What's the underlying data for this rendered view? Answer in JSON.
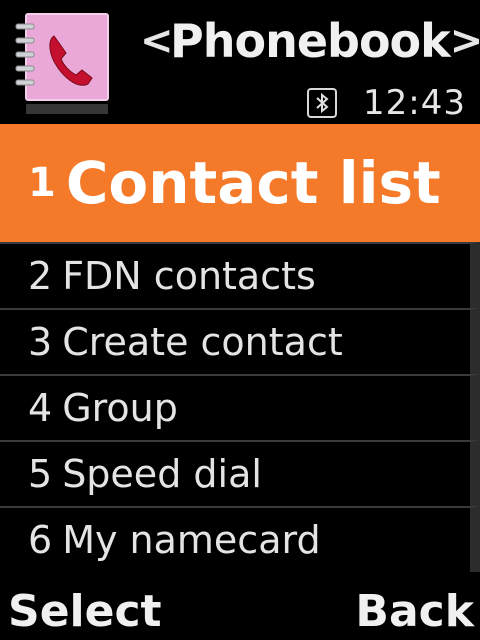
{
  "header": {
    "title": "Phonebook",
    "prev_icon": "chevron-left-icon",
    "next_icon": "chevron-right-icon",
    "app_icon": "phonebook-handset-icon"
  },
  "status": {
    "bluetooth_icon": "bluetooth-icon",
    "time": "12:43"
  },
  "menu": {
    "items": [
      {
        "num": "1",
        "label": "Contact list"
      },
      {
        "num": "2",
        "label": "FDN contacts"
      },
      {
        "num": "3",
        "label": "Create contact"
      },
      {
        "num": "4",
        "label": "Group"
      },
      {
        "num": "5",
        "label": "Speed dial"
      },
      {
        "num": "6",
        "label": "My namecard"
      }
    ],
    "selected_index": 0
  },
  "softkeys": {
    "left": "Select",
    "right": "Back"
  },
  "colors": {
    "highlight": "#f47a2a",
    "background": "#000000",
    "icon_pink": "#e9a8d8",
    "handset_red": "#c4102e"
  }
}
